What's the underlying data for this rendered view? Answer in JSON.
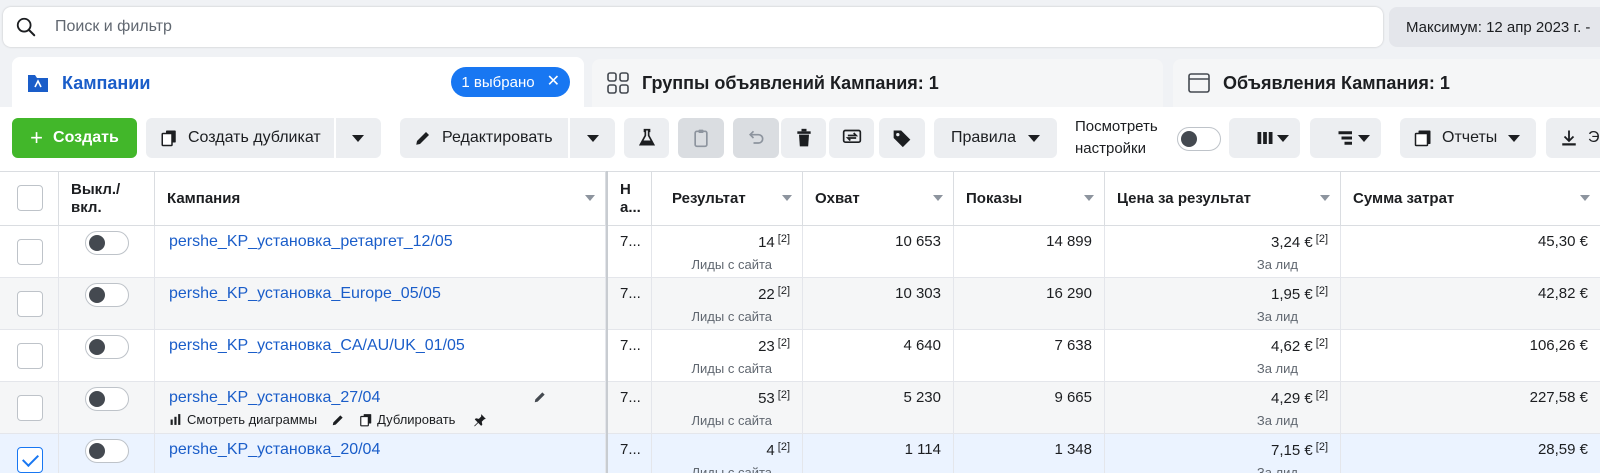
{
  "search": {
    "placeholder": "Поиск и фильтр"
  },
  "date_range": "Максимум: 12 апр 2023 г. - ",
  "tabs": [
    {
      "label": "Кампании",
      "selected_badge": "1 выбрано"
    },
    {
      "label": "Группы объявлений Кампания: 1"
    },
    {
      "label": "Объявления Кампания: 1"
    }
  ],
  "toolbar": {
    "create": "Создать",
    "duplicate": "Создать дубликат",
    "edit": "Редактировать",
    "rules": "Правила",
    "view_settings_line1": "Посмотреть",
    "view_settings_line2": "настройки",
    "reports": "Отчеты",
    "export": "Эк"
  },
  "columns": {
    "toggle_line1": "Выкл./",
    "toggle_line2": "вкл.",
    "campaign": "Кампания",
    "delivery_line1": "Н",
    "delivery_line2": "а...",
    "result": "Результат",
    "reach": "Охват",
    "impressions": "Показы",
    "cost_per_result": "Цена за результат",
    "spend": "Сумма затрат"
  },
  "row_actions": {
    "charts": "Смотреть диаграммы",
    "duplicate": "Дублировать"
  },
  "rows": [
    {
      "name": "pershe_KP_установка_ретаргет_12/05",
      "delivery": "7...",
      "result": "14",
      "result_note": "[2]",
      "result_label": "Лиды с сайта",
      "reach": "10 653",
      "impressions": "14 899",
      "cpr": "3,24 €",
      "cpr_note": "[2]",
      "cpr_label": "За лид",
      "spend": "45,30 €",
      "checked": false
    },
    {
      "name": "pershe_KP_установка_Europe_05/05",
      "delivery": "7...",
      "result": "22",
      "result_note": "[2]",
      "result_label": "Лиды с сайта",
      "reach": "10 303",
      "impressions": "16 290",
      "cpr": "1,95 €",
      "cpr_note": "[2]",
      "cpr_label": "За лид",
      "spend": "42,82 €",
      "checked": false
    },
    {
      "name": "pershe_KP_установка_CA/AU/UK_01/05",
      "delivery": "7...",
      "result": "23",
      "result_note": "[2]",
      "result_label": "Лиды с сайта",
      "reach": "4 640",
      "impressions": "7 638",
      "cpr": "4,62 €",
      "cpr_note": "[2]",
      "cpr_label": "За лид",
      "spend": "106,26 €",
      "checked": false
    },
    {
      "name": "pershe_KP_установка_27/04",
      "delivery": "7...",
      "result": "53",
      "result_note": "[2]",
      "result_label": "Лиды с сайта",
      "reach": "5 230",
      "impressions": "9 665",
      "cpr": "4,29 €",
      "cpr_note": "[2]",
      "cpr_label": "За лид",
      "spend": "227,58 €",
      "checked": false
    },
    {
      "name": "pershe_KP_установка_20/04",
      "delivery": "7...",
      "result": "4",
      "result_note": "[2]",
      "result_label": "Лиды с сайта",
      "reach": "1 114",
      "impressions": "1 348",
      "cpr": "7,15 €",
      "cpr_note": "[2]",
      "cpr_label": "За лид",
      "spend": "28,59 €",
      "checked": true
    }
  ],
  "colors": {
    "brand_blue": "#1877f2",
    "link_blue": "#1a5dc9",
    "create_green": "#42b72a"
  }
}
